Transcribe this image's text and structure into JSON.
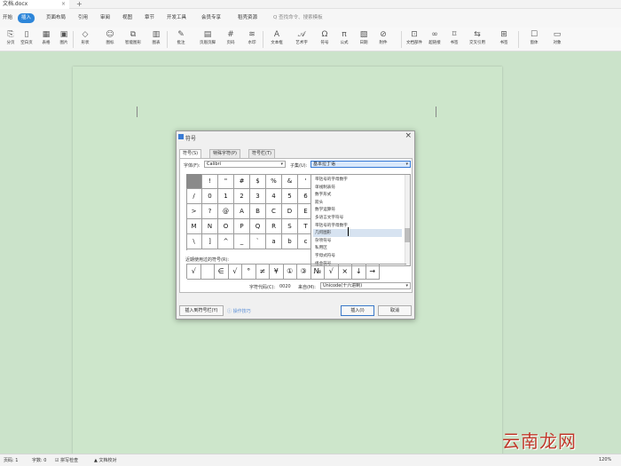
{
  "titlebar": {
    "doc_name": "文档.docx",
    "close": "×",
    "new_tab": "+"
  },
  "menu": {
    "items": [
      "开始",
      "插入",
      "页面布局",
      "引用",
      "审阅",
      "视图",
      "章节",
      "开发工具",
      "会员专享",
      "稻壳资源"
    ],
    "active_index": 1,
    "search": "Q 查找命令、搜索模板"
  },
  "ribbon": {
    "items": [
      "分页",
      "空白页",
      "表格",
      "图片",
      "形状",
      "图标",
      "智能图形",
      "图表",
      "更多",
      "批注",
      "页眉页脚",
      "页码",
      "水印",
      "文本框",
      "艺术字",
      "符号",
      "公式",
      "日期",
      "附件",
      "文档部件",
      "超链接",
      "书签",
      "交叉引用",
      "窗体",
      "对象"
    ]
  },
  "dialog": {
    "title": "符号",
    "close": "×",
    "tabs": [
      "符号(S)",
      "特殊字符(P)",
      "符号栏(T)"
    ],
    "active_tab": 0,
    "font_label": "字体(F):",
    "font_value": "Calibri",
    "subset_label": "子集(U):",
    "subset_value": "基本拉丁语",
    "grid": [
      [
        "",
        "!",
        "\"",
        "#",
        "$",
        "%",
        "&",
        "'"
      ],
      [
        "/",
        "0",
        "1",
        "2",
        "3",
        "4",
        "5",
        "6"
      ],
      [
        ">",
        "?",
        "@",
        "A",
        "B",
        "C",
        "D",
        "E"
      ],
      [
        "M",
        "N",
        "O",
        "P",
        "Q",
        "R",
        "S",
        "T"
      ],
      [
        "\\",
        "]",
        "^",
        "_",
        "`",
        "a",
        "b",
        "c"
      ]
    ],
    "subset_items": [
      "带括号的字母数字",
      "单线制表符",
      "数字形式",
      "箭头",
      "数学运算符",
      "多语言文字符号",
      "带括号的字母数字",
      "几何图形",
      "杂项符号",
      "私用区",
      "字母式符号",
      "组合符号"
    ],
    "subset_highlight": 7,
    "recent_label": "近期使用过的符号(R):",
    "recent": [
      "√",
      "",
      "∈",
      "√",
      "°",
      "≠",
      "¥",
      "①",
      "③",
      "№",
      "√",
      "×",
      "↓",
      "→"
    ],
    "code_label": "字符代码(C):",
    "code_value": "0020",
    "from_label": "来自(M):",
    "from_value": "Unicode(十六进制)",
    "btn_insert_bar": "插入到符号栏(Y)",
    "tips": "操作技巧",
    "btn_insert": "插入(I)",
    "btn_cancel": "取消"
  },
  "status": {
    "page": "页码: 1",
    "words": "字数: 0",
    "spell": "拼写检查",
    "font_missing": "文档校对",
    "zoom": "120%"
  },
  "watermark": "云南龙网"
}
